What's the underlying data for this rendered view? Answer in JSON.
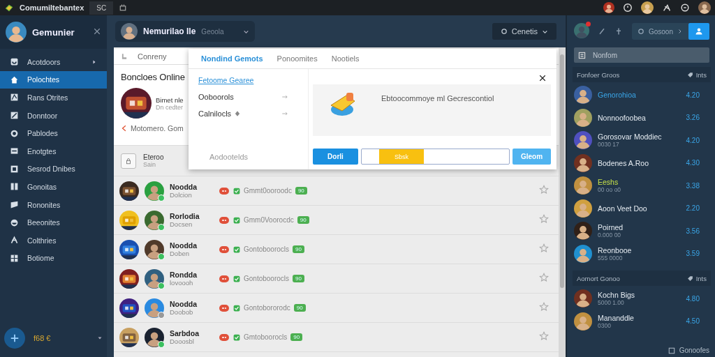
{
  "window": {
    "title": "Comumiltebantex",
    "tab": "SC"
  },
  "sidebar": {
    "user": "Gemunier",
    "items": [
      {
        "label": "Acotdoors",
        "selected": false
      },
      {
        "label": "Polochtes",
        "selected": true
      },
      {
        "label": "Rans Otrites",
        "selected": false
      },
      {
        "label": "Donntoor",
        "selected": false
      },
      {
        "label": "Pablodes",
        "selected": false
      },
      {
        "label": "Enotgtes",
        "selected": false
      },
      {
        "label": "Sesrod Dnibes",
        "selected": false
      },
      {
        "label": "Gonoitas",
        "selected": false
      },
      {
        "label": "Rononites",
        "selected": false
      },
      {
        "label": "Beeonites",
        "selected": false
      },
      {
        "label": "Colthries",
        "selected": false
      },
      {
        "label": "Botiome",
        "selected": false
      }
    ],
    "footer": "f68 €"
  },
  "header": {
    "profile": "Nemurilao Ile",
    "profile_sub": "Geoola",
    "menu_button": "Cenetis"
  },
  "content": {
    "tab": "Conreny",
    "card": {
      "title": "Boncloes Online",
      "name": "Bimet nle",
      "sub": "Dn cedter",
      "meta": "Motomero. Gom"
    },
    "locked_row": {
      "title": "Eteroo",
      "sub": "Sain"
    },
    "rows": [
      {
        "name": "Noodda",
        "sub": "Dolcion",
        "status": "Gmmt0ooroodc",
        "pill": "90",
        "online": true,
        "favorite": false
      },
      {
        "name": "Rorlodia",
        "sub": "Docsen",
        "status": "Gmm0Voorocdc",
        "pill": "90",
        "online": true,
        "favorite": false
      },
      {
        "name": "Noodda",
        "sub": "Doben",
        "status": "Gontoboorocls",
        "pill": "90",
        "online": true,
        "favorite": false
      },
      {
        "name": "Rondda",
        "sub": "lovoooh",
        "status": "Gontoboorocls",
        "pill": "90",
        "online": true,
        "favorite": false
      },
      {
        "name": "Noodda",
        "sub": "Doobob",
        "status": "Gontobororodc",
        "pill": "90",
        "online": false,
        "favorite": false
      },
      {
        "name": "Sarbdoa",
        "sub": "Dooosbl",
        "status": "Gmtoboorocls",
        "pill": "90",
        "online": true,
        "favorite": false
      }
    ]
  },
  "dialog": {
    "tabs": [
      {
        "label": "Nondind Gemots",
        "selected": true
      },
      {
        "label": "Ponoomites",
        "selected": false
      },
      {
        "label": "Nootiels",
        "selected": false
      }
    ],
    "link": "Fetoome Gearee",
    "options": [
      "Ooboorols",
      "Calnilocls"
    ],
    "footer_text": "Aodootelds",
    "message": "Ebtoocommoye ml Gecrescontiol",
    "primary": "Dorli",
    "progress": {
      "label": "Sbsk",
      "level": 0.3
    },
    "secondary": "Gleom"
  },
  "friends": {
    "button": "Gosoon",
    "search": {
      "placeholder": "Nonfom"
    },
    "sections": [
      {
        "title": "Fonfoer Groos",
        "action": "Ints",
        "items": [
          {
            "name": "Genorohioa",
            "value": "4.20",
            "color": "#3aa6e8"
          },
          {
            "name": "Nonnoofoobea",
            "value": "3.26",
            "color": "#e6ecf2"
          },
          {
            "name": "Gorosovar Moddiec",
            "sub": "0030 17",
            "value": "4.20",
            "color": "#e6ecf2"
          },
          {
            "name": "Bodenes A.Roo",
            "value": "4.30",
            "color": "#e6ecf2"
          },
          {
            "name": "Eeshs",
            "sub": "00 oo o0",
            "value": "3.38",
            "color": "#c6e04a"
          },
          {
            "name": "Aoon Veet Doo",
            "value": "2.20",
            "color": "#e6ecf2"
          },
          {
            "name": "Poirned",
            "sub": "0.000 00",
            "value": "3.56",
            "color": "#e6ecf2"
          },
          {
            "name": "Reonbooe",
            "sub": "555 0000",
            "value": "3.59",
            "color": "#e6ecf2"
          }
        ]
      },
      {
        "title": "Aomort Gonoo",
        "action": "Ints",
        "items": [
          {
            "name": "Kochn Bigs",
            "sub": "5000 1.00",
            "value": "4.80",
            "color": "#e6ecf2"
          },
          {
            "name": "Mananddle",
            "sub": "0300",
            "value": "4.50",
            "color": "#e6ecf2"
          }
        ]
      }
    ],
    "footer": "Gonoofes"
  }
}
